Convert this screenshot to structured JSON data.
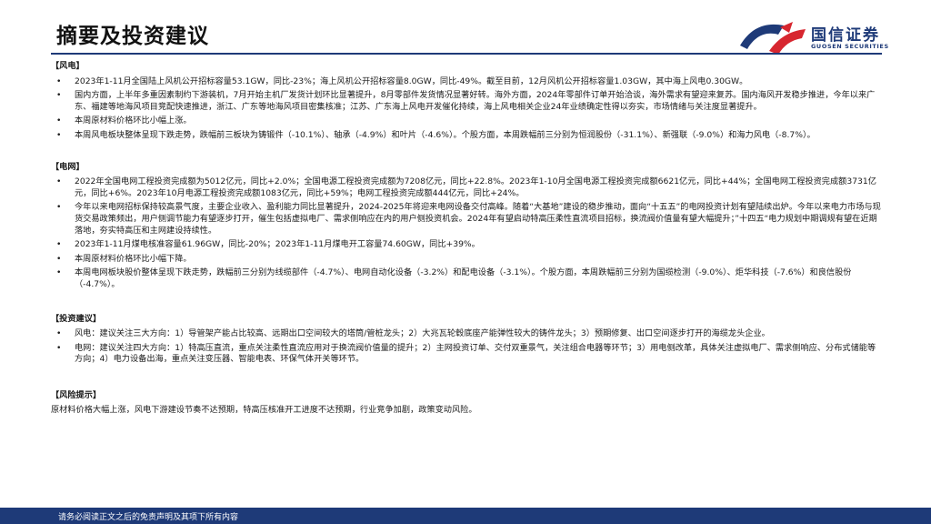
{
  "header": {
    "title": "摘要及投资建议"
  },
  "logo": {
    "name_cn": "国信证券",
    "name_en": "GUOSEN SECURITIES",
    "colors": {
      "navy": "#1e3a78",
      "red": "#d7262f"
    }
  },
  "sections": {
    "wind": {
      "heading": "【风电】",
      "bullets": [
        "2023年1-11月全国陆上风机公开招标容量53.1GW，同比-23%；海上风机公开招标容量8.0GW，同比-49%。截至目前，12月风机公开招标容量1.03GW，其中海上风电0.30GW。",
        "国内方面，上半年多重因素制约下游装机，7月开始主机厂发货计划环比显著提升，8月零部件发货情况显著好转。海外方面，2024年零部件订单开始洽谈，海外需求有望迎来复苏。国内海风开发稳步推进，今年以来广东、福建等地海风项目竞配快速推进，浙江、广东等地海风项目密集核准；江苏、广东海上风电开发催化持续，海上风电相关企业24年业绩确定性得以夯实，市场情绪与关注度显著提升。",
        "本周原材料价格环比小幅上涨。",
        "本周风电板块整体呈现下跌走势，跌幅前三板块为铸锻件（-10.1%）、轴承（-4.9%）和叶片（-4.6%）。个股方面，本周跌幅前三分别为恒润股份（-31.1%）、新强联（-9.0%）和海力风电（-8.7%）。"
      ]
    },
    "grid": {
      "heading": "【电网】",
      "bullets": [
        "2022年全国电网工程投资完成额为5012亿元，同比+2.0%；全国电源工程投资完成额为7208亿元，同比+22.8%。2023年1-10月全国电源工程投资完成额6621亿元，同比+44%；全国电网工程投资完成额3731亿元，同比+6%。2023年10月电源工程投资完成额1083亿元，同比+59%；电网工程投资完成额444亿元，同比+24%。",
        "今年以来电网招标保持较高景气度，主要企业收入、盈利能力同比显著提升，2024-2025年将迎来电网设备交付高峰。随着“大基地”建设的稳步推动，面向“十五五”的电网投资计划有望陆续出炉。今年以来电力市场与现货交易政策频出，用户侧调节能力有望逐步打开，催生包括虚拟电厂、需求侧响应在内的用户侧投资机会。2024年有望启动特高压柔性直流项目招标，换流阀价值量有望大幅提升；”十四五“电力规划中期调规有望在近期落地，夯实特高压和主网建设持续性。",
        "2023年1-11月煤电核准容量61.96GW，同比-20%；2023年1-11月煤电开工容量74.60GW，同比+39%。",
        "本周原材料价格环比小幅下降。",
        "本周电网板块股价整体呈现下跌走势，跌幅前三分别为线缆部件（-4.7%）、电网自动化设备（-3.2%）和配电设备（-3.1%）。个股方面，本周跌幅前三分别为国缆检测（-9.0%）、炬华科技（-7.6%）和良信股份（-4.7%）。"
      ]
    },
    "invest": {
      "heading": "【投资建议】",
      "bullets": [
        "风电：建议关注三大方向：1）导管架产能占比较高、远期出口空间较大的塔筒/管桩龙头；2）大兆瓦轮毂底座产能弹性较大的铸件龙头；3）预期修复、出口空间逐步打开的海缆龙头企业。",
        "电网：建议关注四大方向：1）特高压直流，重点关注柔性直流应用对于换流阀价值量的提升；2）主网投资订单、交付双重景气，关注组合电器等环节；3）用电侧改革，具体关注虚拟电厂、需求侧响应、分布式储能等方向；4）电力设备出海，重点关注变压器、智能电表、环保气体开关等环节。"
      ]
    },
    "risk": {
      "heading": "【风险提示】",
      "text": "原材料价格大幅上涨，风电下游建设节奏不达预期，特高压核准开工进度不达预期，行业竞争加剧，政策变动风险。"
    }
  },
  "footer": {
    "disclaimer": "请务必阅读正文之后的免责声明及其项下所有内容"
  }
}
